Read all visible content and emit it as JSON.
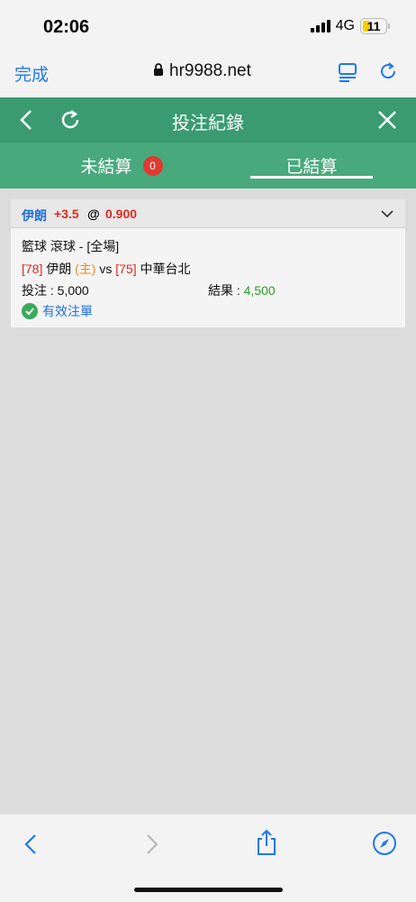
{
  "status_bar": {
    "time": "02:06",
    "network": "4G",
    "battery": "11"
  },
  "browser": {
    "done_label": "完成",
    "url": "hr9988.net"
  },
  "app": {
    "title": "投注紀錄",
    "tabs": [
      {
        "label": "未結算",
        "badge": "0"
      },
      {
        "label": "已結算"
      }
    ]
  },
  "bet": {
    "team": "伊朗",
    "handicap": "+3.5",
    "at": "@",
    "odds": "0.900",
    "sport_line": "籃球 滾球 - [全場]",
    "home_score": "[78]",
    "home_team": "伊朗",
    "home_marker": "(主)",
    "vs": "vs",
    "away_score": "[75]",
    "away_team": "中華台北",
    "stake_label": "投注 : 5,000",
    "result_label": "結果 : ",
    "result_value": "4,500",
    "status": "有效注單"
  },
  "colors": {
    "header_green": "#3a9b70",
    "tab_green": "#48a97d",
    "accent_blue": "#1e78f0",
    "badge_red": "#e03a2f",
    "result_green": "#2a9d2a"
  }
}
